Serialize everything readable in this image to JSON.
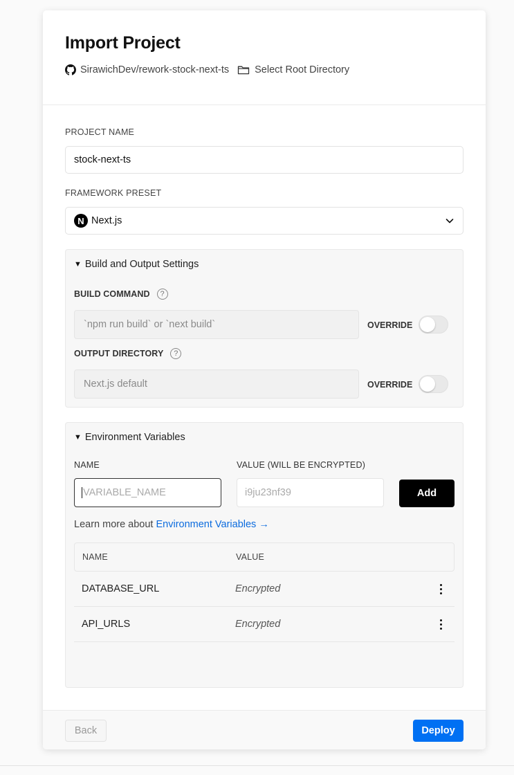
{
  "header": {
    "title": "Import Project",
    "repo": "SirawichDev/rework-stock-next-ts",
    "root_dir_link": "Select Root Directory"
  },
  "project_name": {
    "label": "PROJECT NAME",
    "value": "stock-next-ts"
  },
  "framework": {
    "label": "FRAMEWORK PRESET",
    "value": "Next.js",
    "logo_letter": "N"
  },
  "build_settings": {
    "title": "Build and Output Settings",
    "build_command": {
      "label": "BUILD COMMAND",
      "placeholder": "`npm run build` or `next build`",
      "override_label": "OVERRIDE",
      "override_on": false
    },
    "output_directory": {
      "label": "OUTPUT DIRECTORY",
      "placeholder": "Next.js default",
      "override_label": "OVERRIDE",
      "override_on": false
    },
    "help_glyph": "?"
  },
  "env": {
    "title": "Environment Variables",
    "name_label": "NAME",
    "value_label": "VALUE (WILL BE ENCRYPTED)",
    "name_placeholder": "VARIABLE_NAME",
    "value_placeholder": "i9ju23nf39",
    "add_label": "Add",
    "learn_prefix": "Learn more about ",
    "learn_link": "Environment Variables →",
    "table": {
      "headers": [
        "NAME",
        "VALUE"
      ],
      "rows": [
        {
          "name": "DATABASE_URL",
          "value": "Encrypted"
        },
        {
          "name": "API_URLS",
          "value": "Encrypted"
        }
      ]
    }
  },
  "footer": {
    "back_label": "Back",
    "deploy_label": "Deploy"
  },
  "colors": {
    "accent": "#0070f3",
    "link": "#0b6bde"
  },
  "icons": {
    "repo": "github-icon",
    "folder": "folder-icon",
    "select": "chevron-down-icon",
    "row_menu": "more-vertical-icon"
  }
}
